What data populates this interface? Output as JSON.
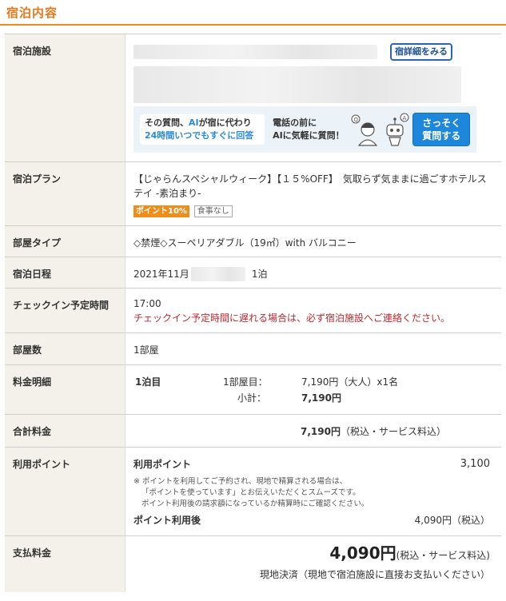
{
  "section_title": "宿泊内容",
  "facility": {
    "label": "宿泊施設",
    "detail_button": "宿詳細をみる",
    "banner": {
      "bubble_line1_pre": "その質問、",
      "bubble_line1_ai": "AI",
      "bubble_line1_post": "が宿に代わり",
      "bubble_line2": "24時間いつでもすぐに回答",
      "phone_line1": "電話の前に",
      "phone_line2": "AIに気軽に質問！",
      "ask_line1": "さっそく",
      "ask_line2": "質問する"
    }
  },
  "plan": {
    "label": "宿泊プラン",
    "name": "【じゃらんスペシャルウィーク】【１５%OFF】　気取らず気ままに過ごすホテルステイ -素泊まり-",
    "point_badge": "ポイント10%",
    "meal_badge": "食事なし"
  },
  "room_type": {
    "label": "部屋タイプ",
    "value": "◇禁煙◇スーペリアダブル（19㎡）with バルコニー"
  },
  "dates": {
    "label": "宿泊日程",
    "value": "2021年11月",
    "nights": "1泊"
  },
  "checkin": {
    "label": "チェックイン予定時間",
    "time": "17:00",
    "warning": "チェックイン予定時間に遅れる場合は、必ず宿泊施設へご連絡ください。"
  },
  "rooms": {
    "label": "部屋数",
    "value": "1部屋"
  },
  "fee_detail": {
    "label": "料金明細",
    "night": "1泊目",
    "room": "1部屋目：",
    "price": "7,190円（大人）x1名",
    "subtotal_label": "小計：",
    "subtotal": "7,190円"
  },
  "total": {
    "label": "合計料金",
    "amount": "7,190円",
    "note": "（税込・サービス料込）"
  },
  "points": {
    "label": "利用ポイント",
    "inner_label": "利用ポイント",
    "value": "3,100",
    "notes": [
      "※ ポイントを利用してご予約され、現地で精算される場合は、",
      "「ポイントを使っています」とお伝えいただくとスムーズです。",
      "ポイント利用後の請求額になっているか精算時にご確認ください。"
    ],
    "after_label": "ポイント利用後",
    "after_value": "4,090円（税込）"
  },
  "payment": {
    "label": "支払料金",
    "amount": "4,090円",
    "amount_note": "(税込・サービス料込)",
    "method": "現地決済（現地で宿泊施設に直接お支払いください）"
  }
}
